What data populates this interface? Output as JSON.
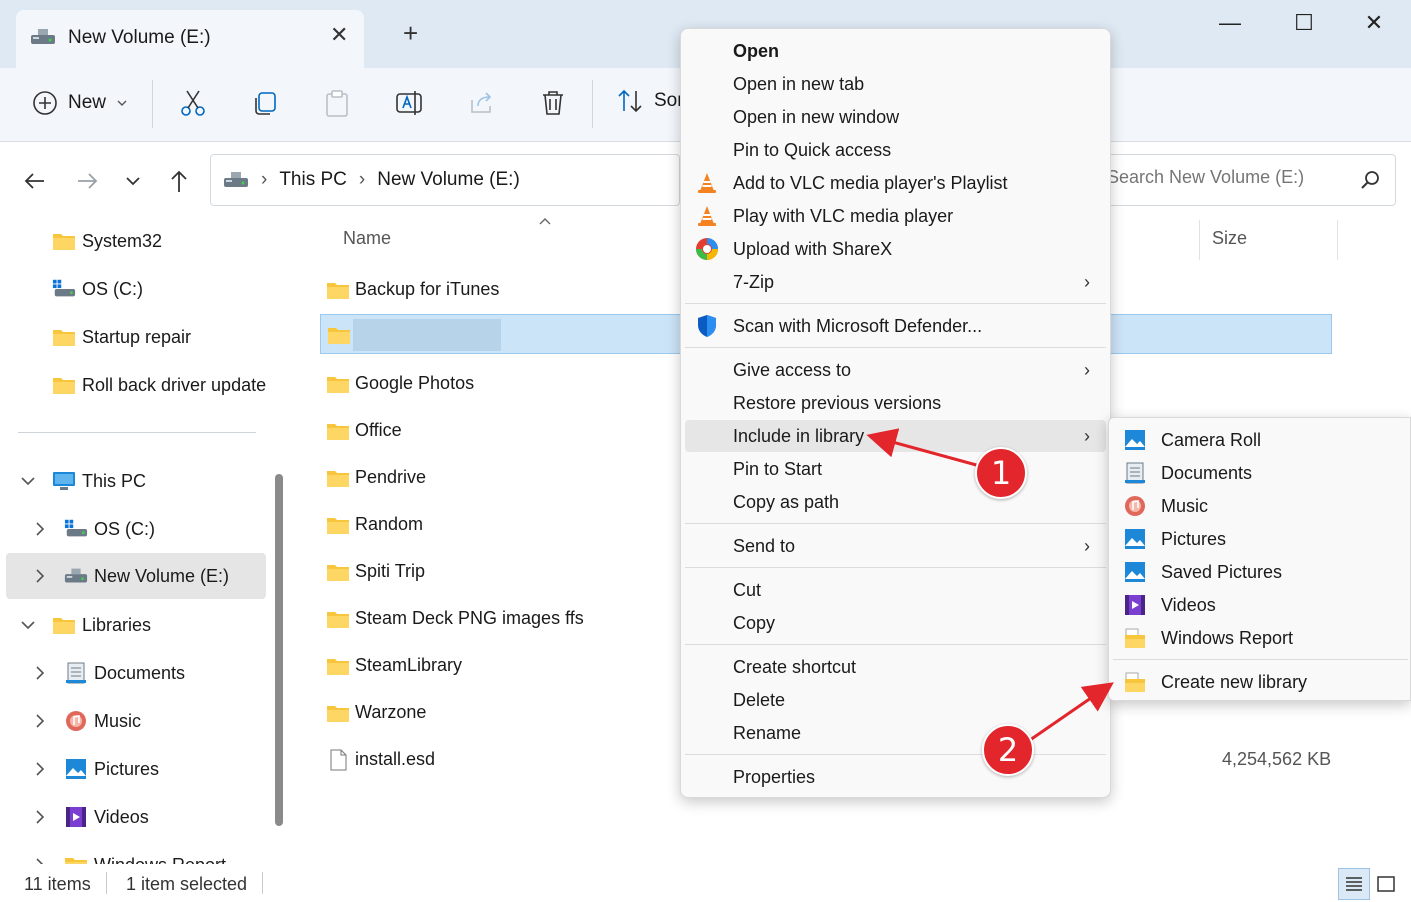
{
  "window": {
    "tab_title": "New Volume (E:)",
    "new_tab_glyph": "+",
    "minimize_glyph": "—",
    "maximize_glyph": "☐",
    "close_glyph": "✕"
  },
  "toolbar": {
    "new_label": "New",
    "sort_label": "Sor"
  },
  "address": {
    "crumbs": [
      "This PC",
      "New Volume (E:)"
    ],
    "search_placeholder": "Search New Volume (E:)"
  },
  "sidebar": {
    "items": [
      {
        "label": "System32",
        "icon": "folder-icon"
      },
      {
        "label": "OS (C:)",
        "icon": "drive-icon"
      },
      {
        "label": "Startup repair",
        "icon": "folder-icon"
      },
      {
        "label": "Roll back driver update",
        "icon": "folder-icon"
      },
      {
        "label": "This PC",
        "icon": "pc-icon"
      },
      {
        "label": "OS (C:)",
        "icon": "drive-icon"
      },
      {
        "label": "New Volume (E:)",
        "icon": "drive-icon"
      },
      {
        "label": "Libraries",
        "icon": "folder-icon"
      },
      {
        "label": "Documents",
        "icon": "documents-icon"
      },
      {
        "label": "Music",
        "icon": "music-icon"
      },
      {
        "label": "Pictures",
        "icon": "pictures-icon"
      },
      {
        "label": "Videos",
        "icon": "videos-icon"
      },
      {
        "label": "Windows Report",
        "icon": "folder-icon"
      }
    ]
  },
  "content": {
    "columns": {
      "name": "Name",
      "size": "Size"
    },
    "rows": [
      {
        "name": "Backup for iTunes",
        "type": "folder",
        "size": ""
      },
      {
        "name": "",
        "type": "folder",
        "size": "",
        "selected": true
      },
      {
        "name": "Google Photos",
        "type": "folder",
        "size": ""
      },
      {
        "name": "Office",
        "type": "folder",
        "size": ""
      },
      {
        "name": "Pendrive",
        "type": "folder",
        "size": ""
      },
      {
        "name": "Random",
        "type": "folder",
        "size": ""
      },
      {
        "name": "Spiti Trip",
        "type": "folder",
        "size": ""
      },
      {
        "name": "Steam Deck PNG images ffs",
        "type": "folder",
        "size": ""
      },
      {
        "name": "SteamLibrary",
        "type": "folder",
        "size": ""
      },
      {
        "name": "Warzone",
        "type": "folder",
        "size": ""
      },
      {
        "name": "install.esd",
        "type": "file",
        "size": "4,254,562 KB"
      }
    ]
  },
  "status": {
    "count": "11 items",
    "selection": "1 item selected"
  },
  "context_menu": {
    "items": [
      {
        "label": "Open",
        "bold": true
      },
      {
        "label": "Open in new tab"
      },
      {
        "label": "Open in new window"
      },
      {
        "label": "Pin to Quick access"
      },
      {
        "label": "Add to VLC media player's Playlist",
        "icon": "vlc-icon"
      },
      {
        "label": "Play with VLC media player",
        "icon": "vlc-icon"
      },
      {
        "label": "Upload with ShareX",
        "icon": "sharex-icon"
      },
      {
        "label": "7-Zip",
        "submenu": true
      },
      {
        "label": "Scan with Microsoft Defender...",
        "icon": "defender-shield-icon"
      },
      {
        "label": "Give access to",
        "submenu": true
      },
      {
        "label": "Restore previous versions"
      },
      {
        "label": "Include in library",
        "submenu": true,
        "highlighted": true
      },
      {
        "label": "Pin to Start"
      },
      {
        "label": "Copy as path"
      },
      {
        "label": "Send to",
        "submenu": true
      },
      {
        "label": "Cut"
      },
      {
        "label": "Copy"
      },
      {
        "label": "Create shortcut"
      },
      {
        "label": "Delete"
      },
      {
        "label": "Rename"
      },
      {
        "label": "Properties"
      }
    ],
    "submenu_arrow": "›"
  },
  "library_submenu": {
    "items": [
      {
        "label": "Camera Roll",
        "icon": "pictures-icon"
      },
      {
        "label": "Documents",
        "icon": "documents-icon"
      },
      {
        "label": "Music",
        "icon": "music-icon"
      },
      {
        "label": "Pictures",
        "icon": "pictures-icon"
      },
      {
        "label": "Saved Pictures",
        "icon": "pictures-icon"
      },
      {
        "label": "Videos",
        "icon": "videos-icon"
      },
      {
        "label": "Windows Report",
        "icon": "library-folder-icon"
      },
      {
        "label": "Create new library",
        "icon": "library-folder-icon"
      }
    ]
  },
  "annotations": {
    "badge_1": "1",
    "badge_2": "2",
    "color": "#e2262c"
  },
  "colors": {
    "accent": "#0067c0",
    "folder": "#f8c63d",
    "selection": "#cce4f7"
  }
}
